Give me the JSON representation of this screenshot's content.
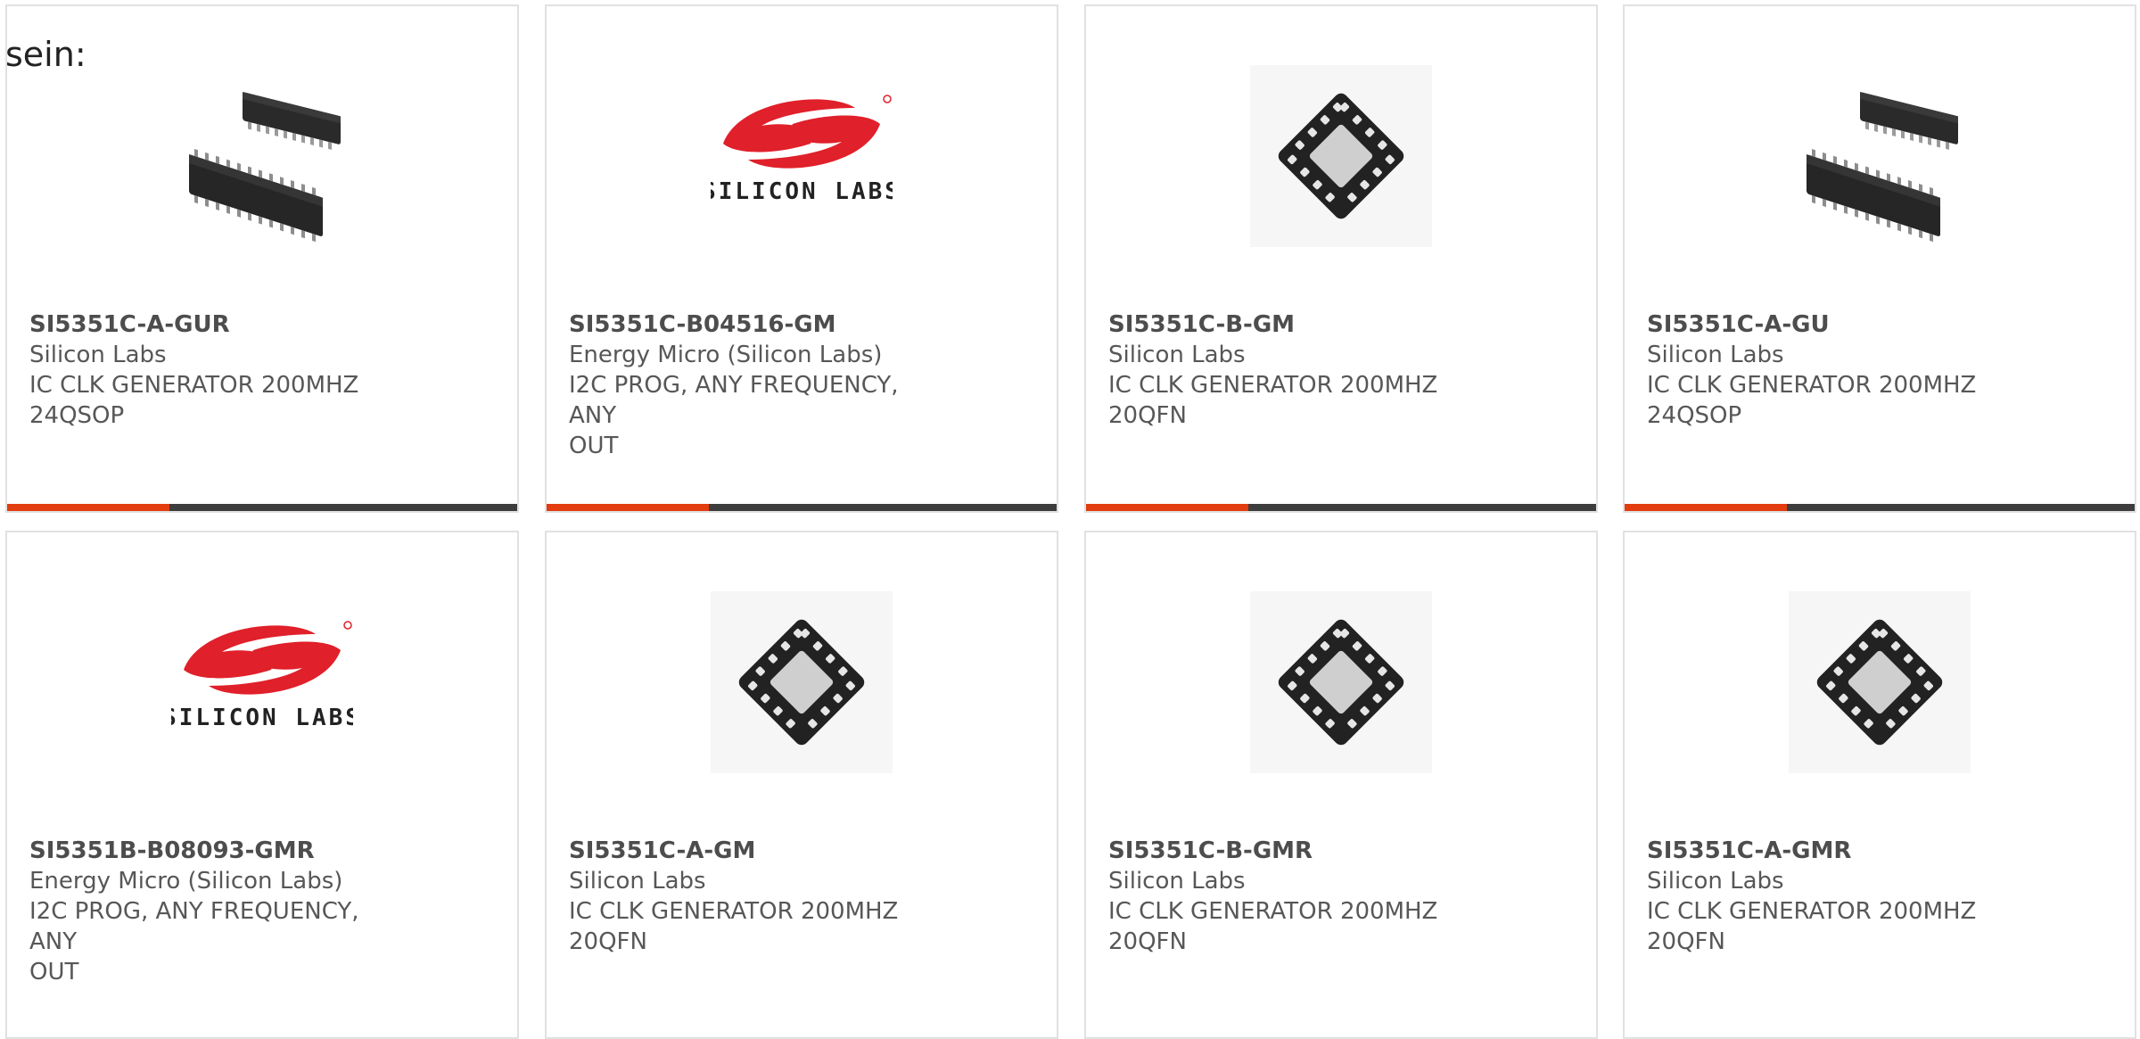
{
  "page": {
    "prefix_text": "sein:"
  },
  "cards": [
    {
      "part": "SI5351C-A-GUR",
      "manufacturer": "Silicon Labs",
      "desc_line1": "IC CLK GENERATOR 200MHZ",
      "desc_line2": "24QSOP",
      "image": "qsop-chip-icon"
    },
    {
      "part": "SI5351C-B04516-GM",
      "manufacturer": "Energy Micro (Silicon Labs)",
      "desc_line1": "I2C PROG, ANY FREQUENCY, ANY",
      "desc_line2": "OUT",
      "image": "silicon-labs-logo"
    },
    {
      "part": "SI5351C-B-GM",
      "manufacturer": "Silicon Labs",
      "desc_line1": "IC CLK GENERATOR 200MHZ",
      "desc_line2": "20QFN",
      "image": "qfn-chip-icon"
    },
    {
      "part": "SI5351C-A-GU",
      "manufacturer": "Silicon Labs",
      "desc_line1": "IC CLK GENERATOR 200MHZ",
      "desc_line2": "24QSOP",
      "image": "qsop-chip-icon"
    },
    {
      "part": "SI5351B-B08093-GMR",
      "manufacturer": "Energy Micro (Silicon Labs)",
      "desc_line1": "I2C PROG, ANY FREQUENCY, ANY",
      "desc_line2": "OUT",
      "image": "silicon-labs-logo"
    },
    {
      "part": "SI5351C-A-GM",
      "manufacturer": "Silicon Labs",
      "desc_line1": "IC CLK GENERATOR 200MHZ",
      "desc_line2": "20QFN",
      "image": "qfn-chip-icon"
    },
    {
      "part": "SI5351C-B-GMR",
      "manufacturer": "Silicon Labs",
      "desc_line1": "IC CLK GENERATOR 200MHZ",
      "desc_line2": "20QFN",
      "image": "qfn-chip-icon"
    },
    {
      "part": "SI5351C-A-GMR",
      "manufacturer": "Silicon Labs",
      "desc_line1": "IC CLK GENERATOR 200MHZ",
      "desc_line2": "20QFN",
      "image": "qfn-chip-icon"
    }
  ],
  "logo": {
    "text": "SILICON LABS",
    "color": "#e0202a"
  },
  "colors": {
    "accent": "#e23c0f",
    "bar": "#3d3d3d",
    "border": "#e1e1e1"
  }
}
